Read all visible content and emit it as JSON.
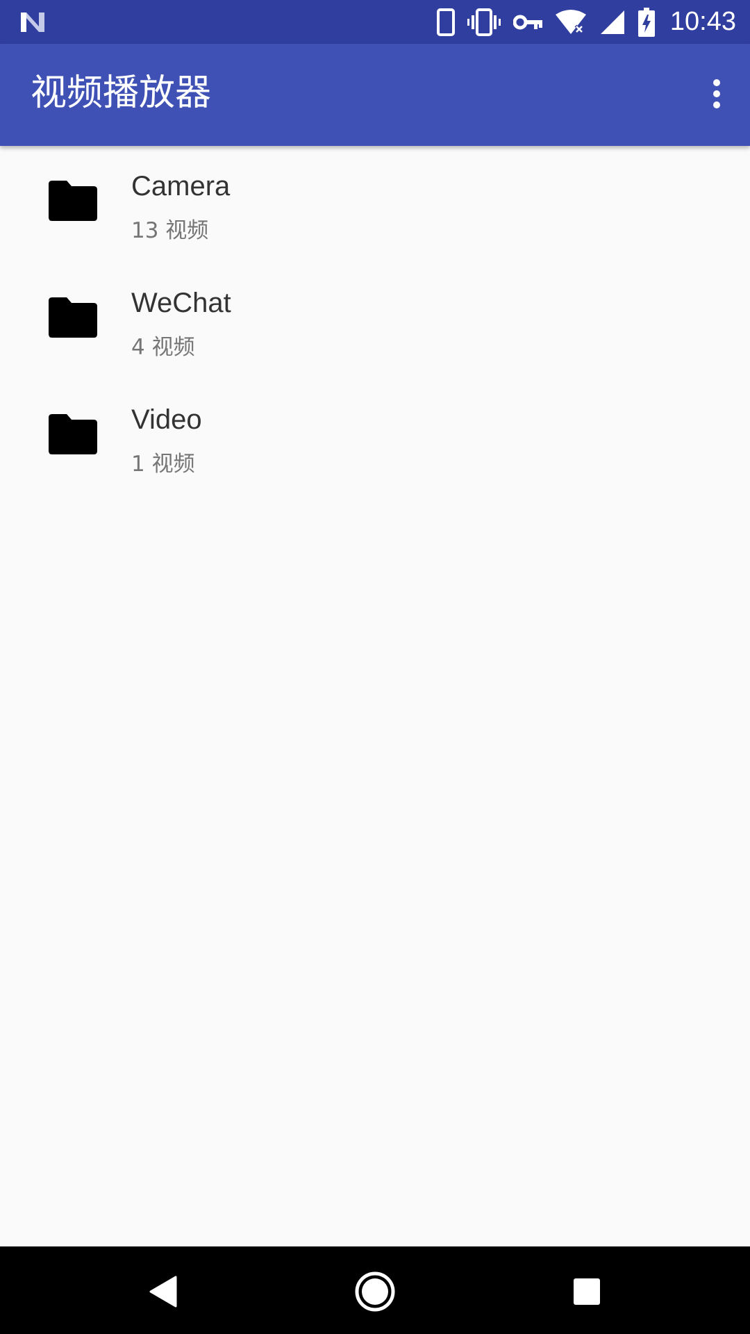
{
  "status_bar": {
    "time": "10:43",
    "left_icon": "notification-n-icon",
    "icons": [
      "phone-icon",
      "vibrate-icon",
      "vpn-key-icon",
      "wifi-icon",
      "signal-icon",
      "battery-charging-icon"
    ]
  },
  "app_bar": {
    "title": "视频播放器",
    "overflow_icon": "more-vert-icon",
    "background": "#3f51b5",
    "status_background": "#303f9f"
  },
  "folders": [
    {
      "name": "Camera",
      "count": "13 视频",
      "icon": "folder-icon"
    },
    {
      "name": "WeChat",
      "count": "4 视频",
      "icon": "folder-icon"
    },
    {
      "name": "Video",
      "count": "1 视频",
      "icon": "folder-icon"
    }
  ],
  "nav_bar": {
    "back_icon": "back-icon",
    "home_icon": "home-icon",
    "recents_icon": "recents-icon"
  }
}
